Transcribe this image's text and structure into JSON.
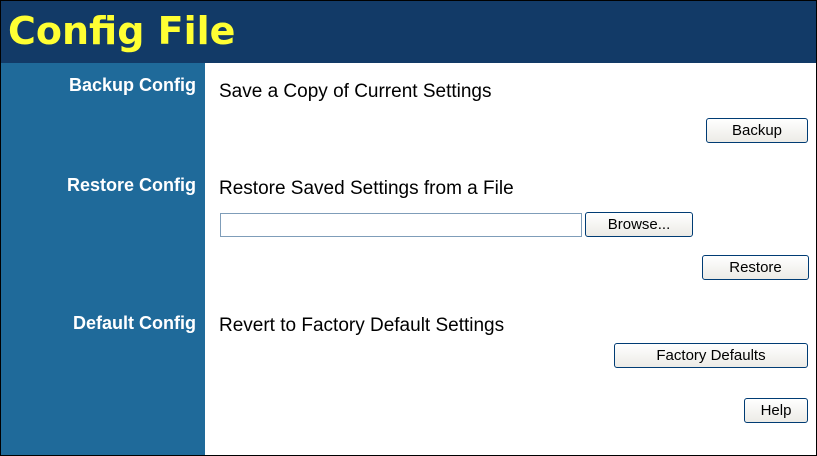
{
  "page": {
    "title": "Config File"
  },
  "colors": {
    "header_bg": "#123a67",
    "title_text": "#ffff33",
    "sidebar_bg": "#1f6a9a",
    "sidebar_text": "#ffffff"
  },
  "sections": {
    "backup": {
      "label": "Backup Config",
      "description": "Save a Copy of Current Settings",
      "button": "Backup"
    },
    "restore": {
      "label": "Restore Config",
      "description": "Restore Saved Settings from a File",
      "file_value": "",
      "browse_button": "Browse...",
      "button": "Restore"
    },
    "default": {
      "label": "Default Config",
      "description": "Revert to Factory Default Settings",
      "button": "Factory Defaults"
    }
  },
  "help_button": "Help"
}
